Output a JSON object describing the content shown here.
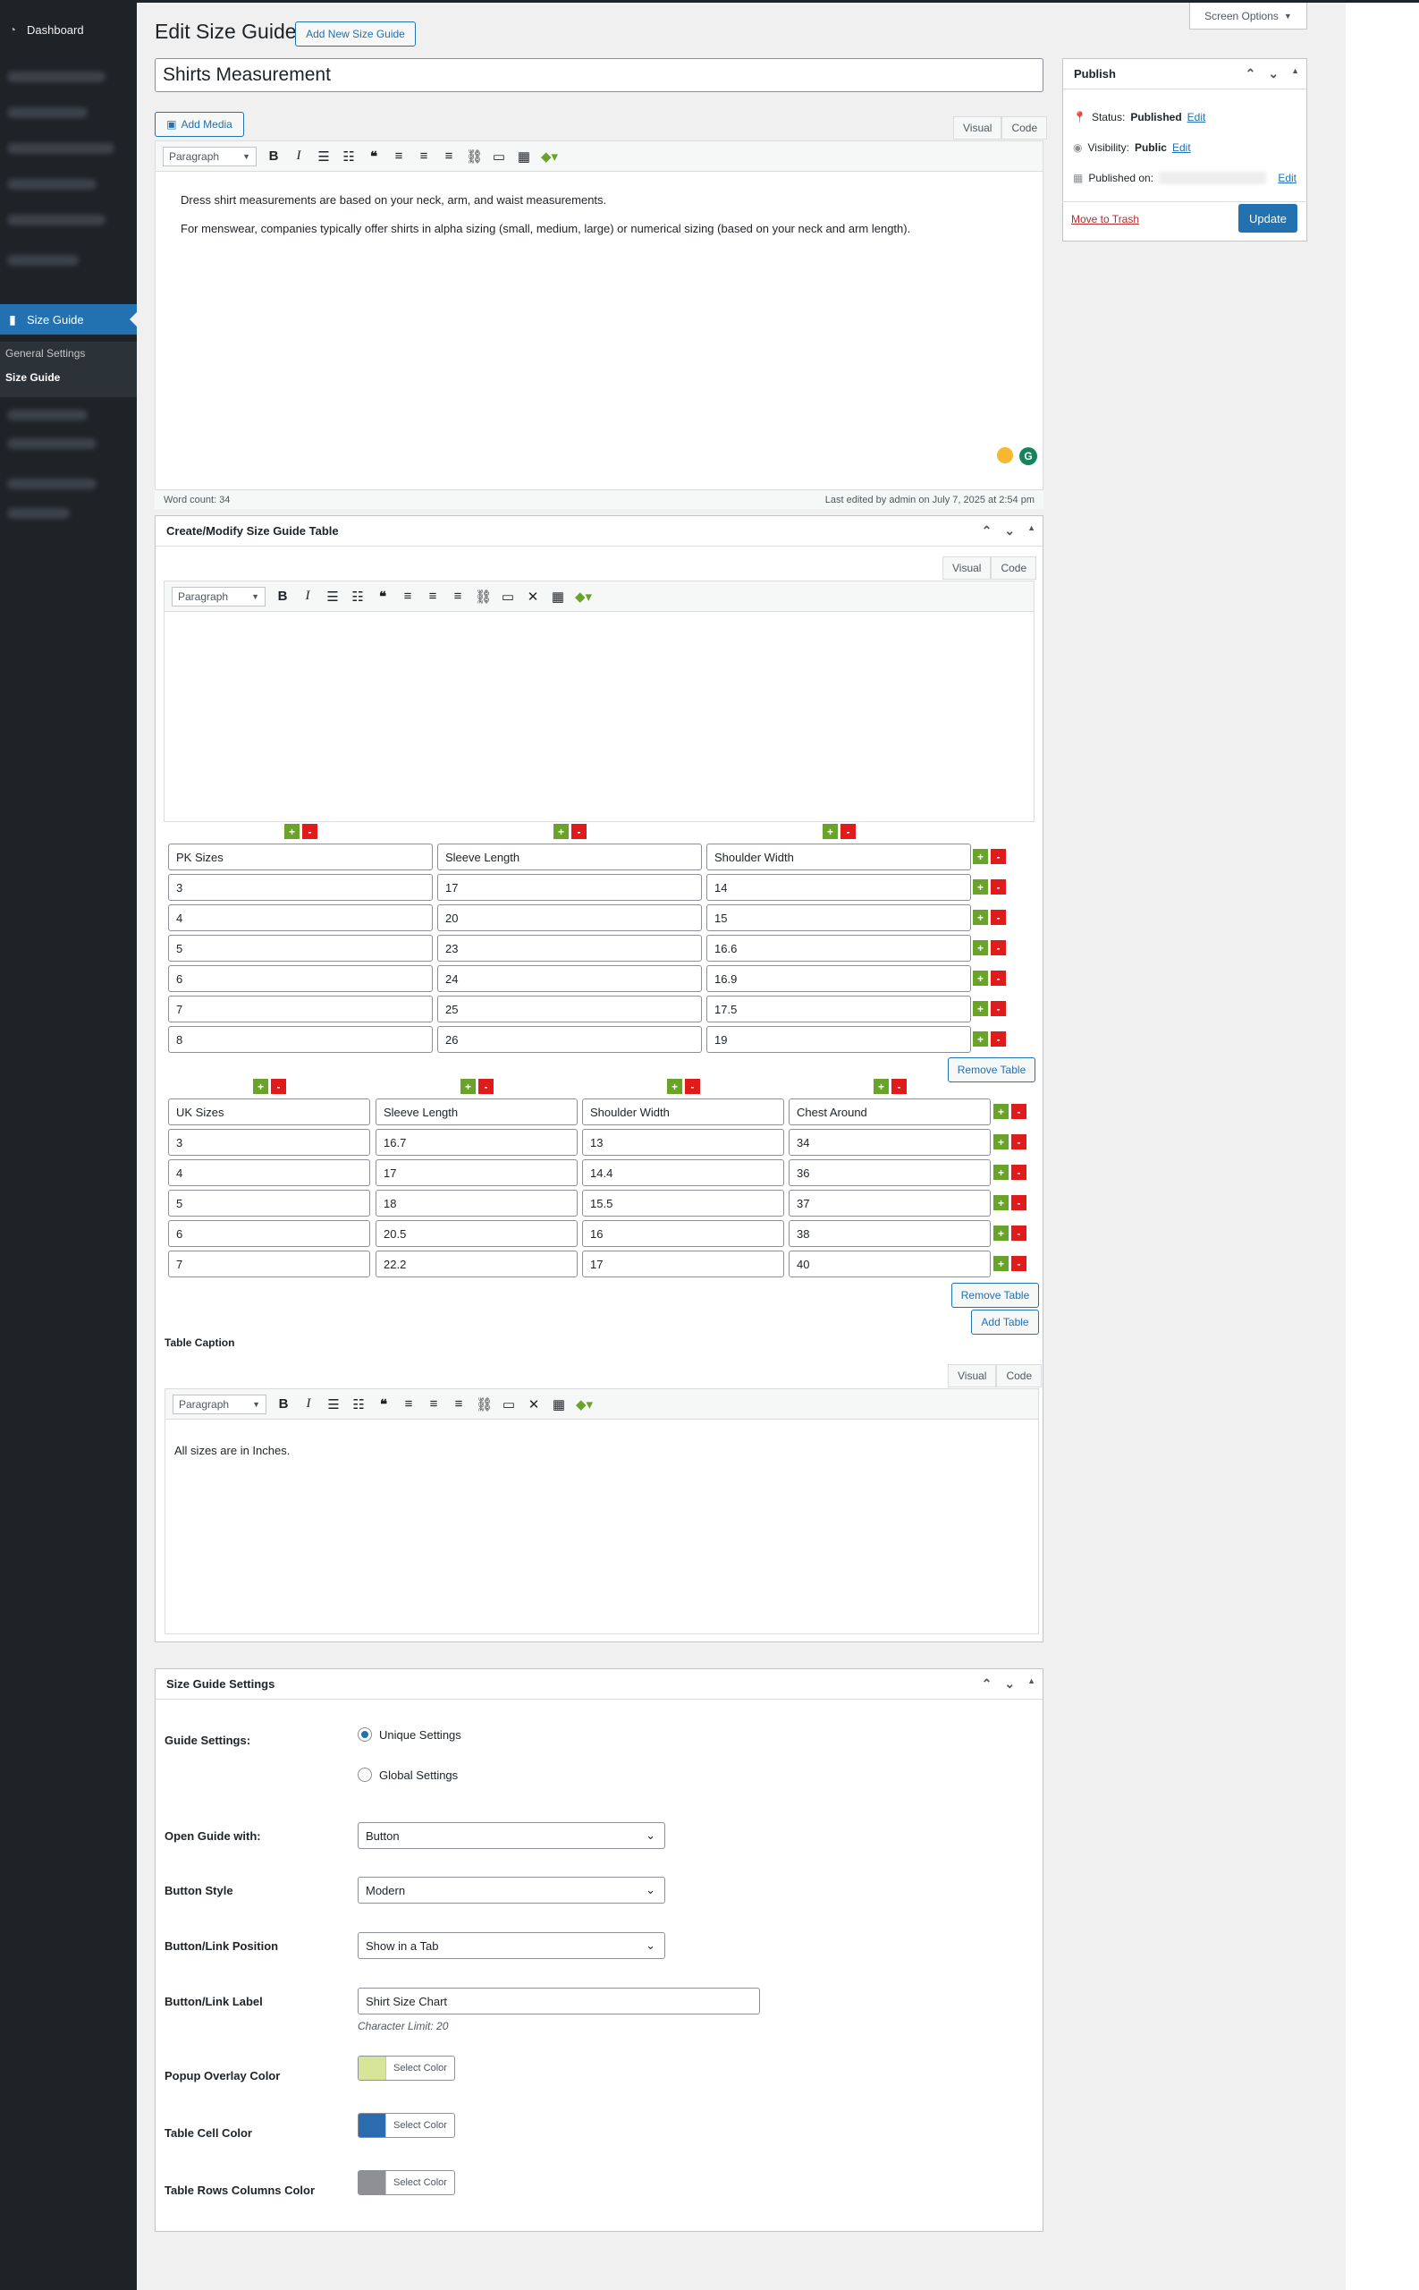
{
  "sidebar": {
    "dashboard": "Dashboard",
    "size_guide": "Size Guide",
    "sub": [
      "General Settings",
      "Size Guide"
    ]
  },
  "header": {
    "title": "Edit Size Guide",
    "add_new": "Add New Size Guide",
    "screen_options": "Screen Options"
  },
  "post_title": "Shirts Measurement",
  "editor": {
    "add_media": "Add Media",
    "tab_visual": "Visual",
    "tab_code": "Code",
    "paragraph": "Paragraph",
    "content": [
      "Dress shirt measurements are based on your neck, arm, and waist measurements.",
      "For menswear, companies typically offer shirts in alpha sizing (small, medium, large) or numerical sizing (based on your neck and arm length)."
    ],
    "word_count": "Word count: 34",
    "last_edited": "Last edited by admin on July 7, 2025 at 2:54 pm"
  },
  "publish": {
    "title": "Publish",
    "status_label": "Status:",
    "status_value": "Published",
    "visibility_label": "Visibility:",
    "visibility_value": "Public",
    "published_label": "Published on:",
    "edit": "Edit",
    "trash": "Move to Trash",
    "update": "Update"
  },
  "table_box": {
    "title": "Create/Modify Size Guide Table",
    "tab_visual": "Visual",
    "tab_code": "Code",
    "paragraph": "Paragraph",
    "table1": {
      "rows": [
        [
          "PK Sizes",
          "Sleeve Length",
          "Shoulder Width"
        ],
        [
          "3",
          "17",
          "14"
        ],
        [
          "4",
          "20",
          "15"
        ],
        [
          "5",
          "23",
          "16.6"
        ],
        [
          "6",
          "24",
          "16.9"
        ],
        [
          "7",
          "25",
          "17.5"
        ],
        [
          "8",
          "26",
          "19"
        ]
      ]
    },
    "table2": {
      "rows": [
        [
          "UK Sizes",
          "Sleeve Length",
          "Shoulder Width",
          "Chest Around"
        ],
        [
          "3",
          "16.7",
          "13",
          "34"
        ],
        [
          "4",
          "17",
          "14.4",
          "36"
        ],
        [
          "5",
          "18",
          "15.5",
          "37"
        ],
        [
          "6",
          "20.5",
          "16",
          "38"
        ],
        [
          "7",
          "22.2",
          "17",
          "40"
        ]
      ]
    },
    "remove_table": "Remove Table",
    "add_table": "Add Table",
    "caption_label": "Table Caption",
    "caption_text": "All sizes are in Inches."
  },
  "settings": {
    "title": "Size Guide Settings",
    "guide_settings_label": "Guide Settings:",
    "unique": "Unique Settings",
    "global": "Global Settings",
    "open_with_label": "Open Guide with:",
    "open_with_value": "Button",
    "button_style_label": "Button Style",
    "button_style_value": "Modern",
    "position_label": "Button/Link Position",
    "position_value": "Show in a Tab",
    "link_label_label": "Button/Link Label",
    "link_label_value": "Shirt Size Chart",
    "char_limit": "Character Limit: 20",
    "overlay_label": "Popup Overlay Color",
    "cell_color_label": "Table Cell Color",
    "rows_cols_label": "Table Rows Columns Color",
    "select_color": "Select Color",
    "colors": {
      "overlay": "#d6e59a",
      "cell": "#2b6cb0",
      "rows_cols": "#8e9093"
    }
  }
}
